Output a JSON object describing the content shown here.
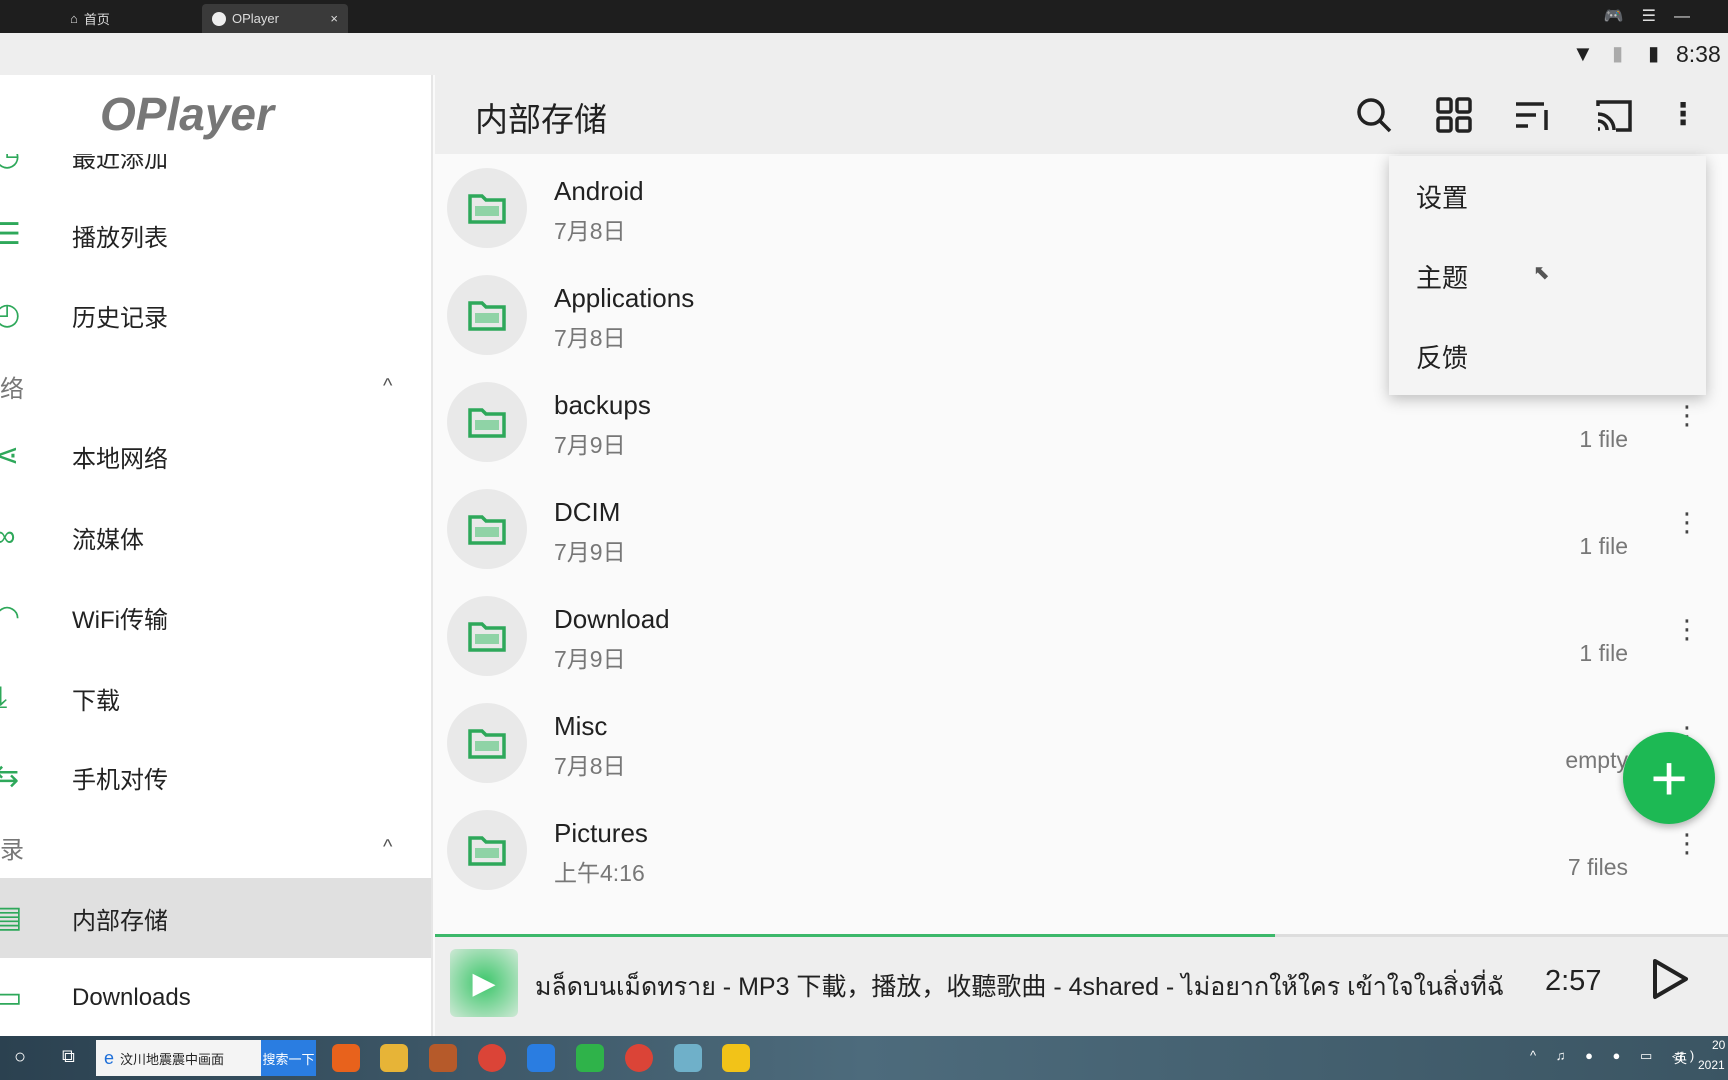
{
  "browser_tabs": [
    {
      "label": "首页",
      "icon": "home-icon"
    },
    {
      "label": "OPlayer",
      "icon": "oplayer-icon",
      "close": "×"
    }
  ],
  "status": {
    "time": "8:38",
    "icons": [
      "wifi-icon",
      "no-sim-icon",
      "battery-charging-icon"
    ]
  },
  "sidebar": {
    "logo": "OPlayer",
    "items": [
      {
        "label": "最近添加",
        "icon": "recent-icon"
      },
      {
        "label": "播放列表",
        "icon": "playlist-icon"
      },
      {
        "label": "历史记录",
        "icon": "history-icon"
      },
      {
        "label": "络",
        "type": "section",
        "chevron": "^"
      },
      {
        "label": "本地网络",
        "icon": "share-network-icon"
      },
      {
        "label": "流媒体",
        "icon": "link-icon"
      },
      {
        "label": "WiFi传输",
        "icon": "wifi-icon"
      },
      {
        "label": "下载",
        "icon": "download-icon"
      },
      {
        "label": "手机对传",
        "icon": "transfer-icon"
      },
      {
        "label": "录",
        "type": "section",
        "chevron": "^"
      },
      {
        "label": "内部存储",
        "icon": "storage-icon",
        "selected": true
      },
      {
        "label": "Downloads",
        "icon": "downloads-folder-icon"
      }
    ]
  },
  "appbar": {
    "title": "内部存储",
    "actions": [
      "search-icon",
      "grid-view-icon",
      "sort-icon",
      "cast-icon",
      "more-vert-icon"
    ]
  },
  "menu": {
    "items": [
      "设置",
      "主题",
      "反馈"
    ]
  },
  "files": [
    {
      "name": "Android",
      "date": "7月8日",
      "count": ""
    },
    {
      "name": "Applications",
      "date": "7月8日",
      "count": ""
    },
    {
      "name": "backups",
      "date": "7月9日",
      "count": "1 file"
    },
    {
      "name": "DCIM",
      "date": "7月9日",
      "count": "1 file"
    },
    {
      "name": "Download",
      "date": "7月9日",
      "count": "1 file"
    },
    {
      "name": "Misc",
      "date": "7月8日",
      "count": "empty"
    },
    {
      "name": "Pictures",
      "date": "上午4:16",
      "count": "7 files"
    }
  ],
  "player": {
    "title": "มล็ดบนเม็ดทราย - MP3 下載，播放，收聽歌曲 - 4shared - ไม่อยากให้ใคร เข้าใจในสิ่งที่ฉั",
    "time": "2:57",
    "progress_fraction": 0.65
  },
  "taskbar": {
    "search_text": "汶川地震震中画面",
    "search_button": "搜索一下",
    "ime": "英",
    "clock_partial": "20",
    "date_partial": "2021"
  },
  "colors": {
    "accent": "#1db954"
  }
}
